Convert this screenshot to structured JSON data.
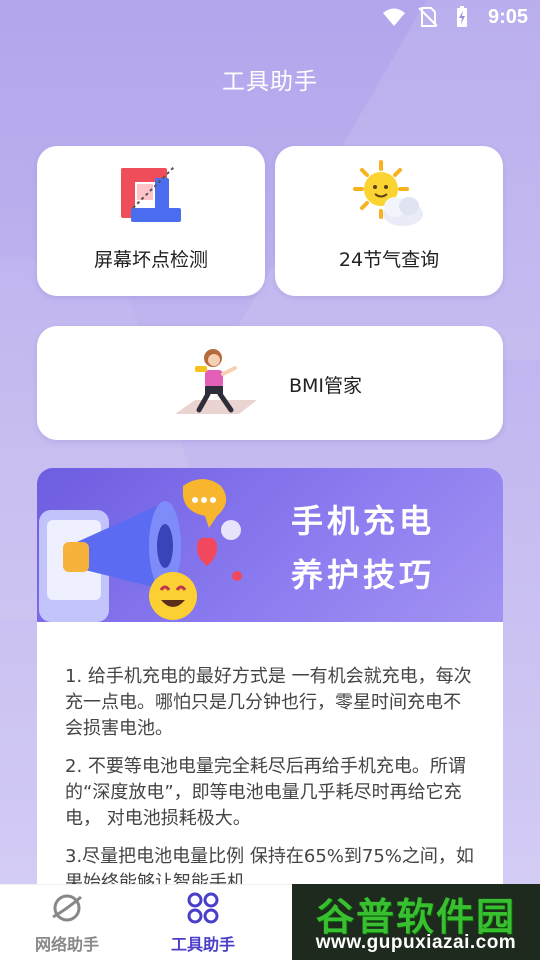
{
  "status_bar": {
    "time": "9:05",
    "icons": [
      "wifi-icon",
      "no-sim-icon",
      "battery-charging-icon"
    ]
  },
  "header": {
    "title": "工具助手"
  },
  "tools": [
    {
      "label": "屏幕坏点检测",
      "icon": "crop-icon"
    },
    {
      "label": "24节气查询",
      "icon": "sun-cloud-icon"
    },
    {
      "label": "BMI管家",
      "icon": "fitness-girl-icon"
    }
  ],
  "banner": {
    "line1": "手机充电",
    "line2": "养护技巧",
    "icon": "megaphone-icon"
  },
  "tips": [
    "1. 给手机充电的最好方式是 一有机会就充电，每次充一点电。哪怕只是几分钟也行，零星时间充电不会损害电池。",
    "2. 不要等电池电量完全耗尽后再给手机充电。所谓的“深度放电”，即等电池电量几乎耗尽时再给它充电， 对电池损耗极大。",
    "3.尽量把电池电量比例 保持在65%到75%之间，如果始终能够让智能手机..."
  ],
  "bottom_nav": [
    {
      "label": "网络助手",
      "icon": "planet-icon",
      "active": false
    },
    {
      "label": "工具助手",
      "icon": "tools-grid-icon",
      "active": true
    }
  ],
  "watermark": {
    "title": "谷普软件园",
    "url": "www.gupuxiazai.com"
  },
  "colors": {
    "accent": "#4b3fc9",
    "background_top": "#b3a5ec",
    "banner": "#6d5de0"
  }
}
